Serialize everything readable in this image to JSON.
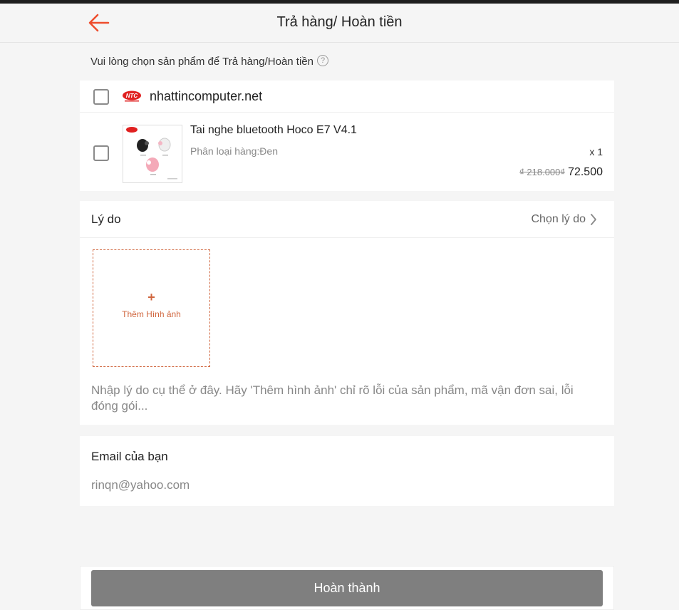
{
  "header": {
    "title": "Trả hàng/ Hoàn tiền"
  },
  "instruction": {
    "text": "Vui lòng chọn sản phẩm để Trả hàng/Hoàn tiền",
    "help_symbol": "?"
  },
  "shop": {
    "name": "nhattincomputer.net",
    "logo_text": "NTC",
    "checked": false
  },
  "product": {
    "name": "Tai nghe bluetooth Hoco E7 V4.1",
    "variant": "Phân loại hàng:Đen",
    "quantity": "x 1",
    "original_price": "₫ 218.000₫",
    "price": "72.500",
    "checked": false
  },
  "reason": {
    "label": "Lý do",
    "select_placeholder": "Chọn lý do",
    "add_photo_label": "Thêm Hình ảnh",
    "add_photo_symbol": "+",
    "details_placeholder": "Nhập lý do cụ thể ở đây. Hãy 'Thêm hình ảnh' chỉ rõ lỗi của sản phẩm, mã vận đơn sai, lỗi đóng gói..."
  },
  "email": {
    "label": "Email của bạn",
    "value": "rinqn@yahoo.com"
  },
  "footer": {
    "submit_label": "Hoàn thành"
  },
  "colors": {
    "accent": "#ee4d2d",
    "add_photo": "#d0663e",
    "button_disabled": "#7f7f7f",
    "background": "#f5f5f5"
  },
  "icons": {
    "back": "arrow-left-icon",
    "help": "question-circle-icon",
    "chevron": "chevron-right-icon"
  }
}
